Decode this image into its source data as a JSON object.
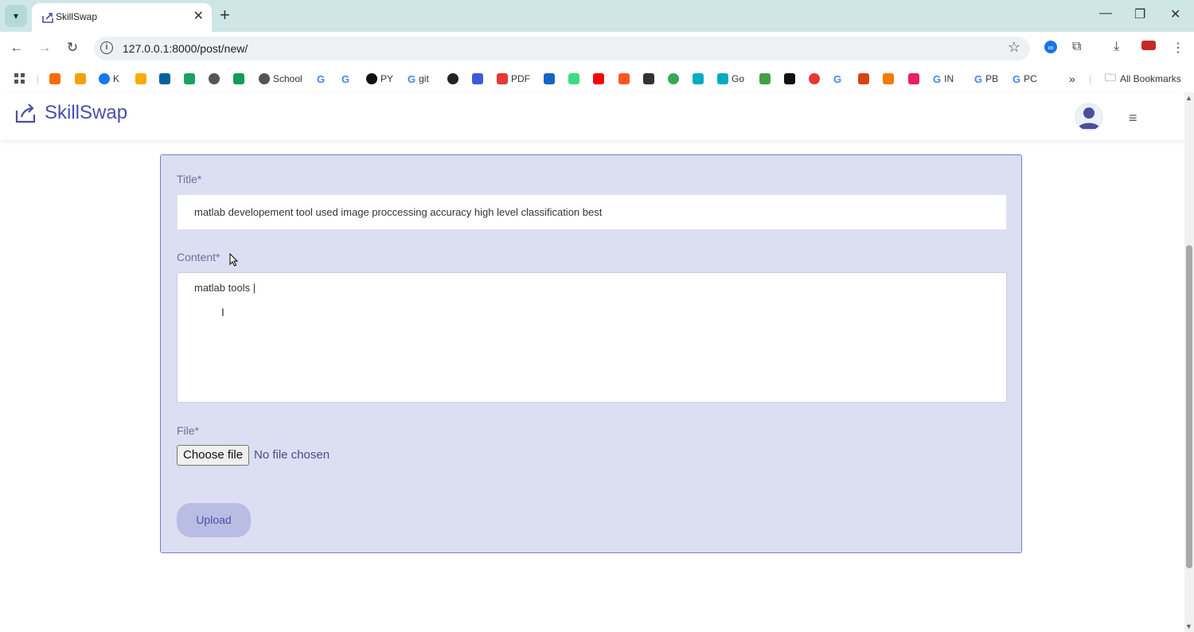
{
  "browser": {
    "tab_title": "SkillSwap",
    "url": "127.0.0.1:8000/post/new/",
    "bookmarks": [
      {
        "label": "",
        "icon": "arrows-icon"
      },
      {
        "label": "",
        "icon": "orange-book-icon"
      },
      {
        "label": "K",
        "icon": "facebook-icon"
      },
      {
        "label": "",
        "icon": "chart-icon"
      },
      {
        "label": "",
        "icon": "ieee-icon"
      },
      {
        "label": "",
        "icon": "s-icon"
      },
      {
        "label": "",
        "icon": "globe-icon"
      },
      {
        "label": "",
        "icon": "plus-green-icon"
      },
      {
        "label": "School",
        "icon": "globe-icon"
      },
      {
        "label": "",
        "icon": "google-icon"
      },
      {
        "label": "",
        "icon": "google-icon"
      },
      {
        "label": "PY",
        "icon": "github-icon"
      },
      {
        "label": "git",
        "icon": "google-icon"
      },
      {
        "label": "",
        "icon": "circle-icon"
      },
      {
        "label": "",
        "icon": "bird-icon"
      },
      {
        "label": "PDF",
        "icon": "pdf-icon"
      },
      {
        "label": "",
        "icon": "blue-h-icon"
      },
      {
        "label": "",
        "icon": "android-icon"
      },
      {
        "label": "",
        "icon": "youtube-icon"
      },
      {
        "label": "",
        "icon": "z-icon"
      },
      {
        "label": "",
        "icon": "dark-icon"
      },
      {
        "label": "",
        "icon": "green-ring-icon"
      },
      {
        "label": "",
        "icon": "heart-icon"
      },
      {
        "label": "Go",
        "icon": "heart-icon"
      },
      {
        "label": "",
        "icon": "green-square-icon"
      },
      {
        "label": "",
        "icon": "c-icon"
      },
      {
        "label": "",
        "icon": "red-circle-icon"
      },
      {
        "label": "",
        "icon": "google-icon"
      },
      {
        "label": "",
        "icon": "matlab-icon"
      },
      {
        "label": "",
        "icon": "fish-icon"
      },
      {
        "label": "",
        "icon": "heart-red-icon"
      },
      {
        "label": "IN",
        "icon": "google-icon"
      },
      {
        "label": "PB",
        "icon": "google-icon"
      },
      {
        "label": "PC",
        "icon": "google-icon"
      }
    ],
    "all_bookmarks": "All Bookmarks",
    "more": "»"
  },
  "app": {
    "brand": "SkillSwap"
  },
  "form": {
    "title_label": "Title*",
    "title_value": "matlab developement tool used image proccessing accuracy high level classification best",
    "content_label": "Content*",
    "content_value": "matlab tools |",
    "file_label": "File*",
    "file_button": "Choose file",
    "file_status": "No file chosen",
    "upload_button": "Upload"
  }
}
